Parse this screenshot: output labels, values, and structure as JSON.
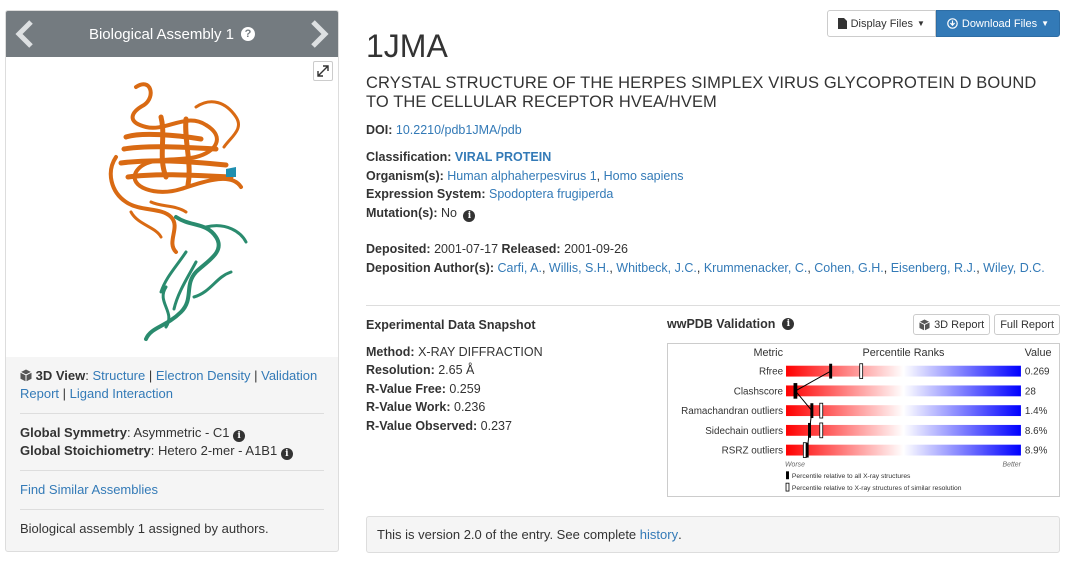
{
  "assembly": {
    "header": "Biological Assembly 1",
    "view_label": "3D View",
    "view_links": [
      "Structure",
      "Electron Density",
      "Validation Report",
      "Ligand Interaction"
    ],
    "symmetry_label": "Global Symmetry",
    "symmetry_value": "Asymmetric - C1",
    "stoich_label": "Global Stoichiometry",
    "stoich_value": "Hetero 2-mer - A1B1",
    "find_similar": "Find Similar Assemblies",
    "assigned_note": "Biological assembly 1 assigned by authors."
  },
  "toolbar": {
    "display_files": "Display Files",
    "download_files": "Download Files"
  },
  "entry": {
    "id": "1JMA",
    "title": "CRYSTAL STRUCTURE OF THE HERPES SIMPLEX VIRUS GLYCOPROTEIN D BOUND TO THE CELLULAR RECEPTOR HVEA/HVEM",
    "doi_label": "DOI:",
    "doi": "10.2210/pdb1JMA/pdb",
    "classification_label": "Classification:",
    "classification": "VIRAL PROTEIN",
    "organisms_label": "Organism(s):",
    "organisms": [
      "Human alphaherpesvirus 1",
      "Homo sapiens"
    ],
    "expression_label": "Expression System:",
    "expression": "Spodoptera frugiperda",
    "mutation_label": "Mutation(s):",
    "mutation": "No",
    "deposited_label": "Deposited:",
    "deposited": "2001-07-17",
    "released_label": "Released:",
    "released": "2001-09-26",
    "authors_label": "Deposition Author(s):",
    "authors": [
      "Carfi, A.",
      "Willis, S.H.",
      "Whitbeck, J.C.",
      "Krummenacker, C.",
      "Cohen, G.H.",
      "Eisenberg, R.J.",
      "Wiley, D.C."
    ]
  },
  "snapshot": {
    "heading": "Experimental Data Snapshot",
    "rows": [
      {
        "label": "Method:",
        "value": "X-RAY DIFFRACTION"
      },
      {
        "label": "Resolution:",
        "value": "2.65 Å"
      },
      {
        "label": "R-Value Free:",
        "value": "0.259"
      },
      {
        "label": "R-Value Work:",
        "value": "0.236"
      },
      {
        "label": "R-Value Observed:",
        "value": "0.237"
      }
    ]
  },
  "validation": {
    "heading": "wwPDB Validation",
    "report_3d": "3D Report",
    "full_report": "Full Report",
    "col_metric": "Metric",
    "col_percentile": "Percentile Ranks",
    "col_value": "Value",
    "worse": "Worse",
    "better": "Better",
    "legend_all": "Percentile relative to all X-ray structures",
    "legend_similar": "Percentile relative to X-ray structures of similar resolution",
    "metrics": [
      {
        "name": "Rfree",
        "value": "0.269",
        "pct_all": 0.19,
        "pct_similar": 0.32
      },
      {
        "name": "Clashscore",
        "value": "28",
        "pct_all": 0.04,
        "pct_similar": 0.04
      },
      {
        "name": "Ramachandran outliers",
        "value": "1.4%",
        "pct_all": 0.11,
        "pct_similar": 0.15
      },
      {
        "name": "Sidechain outliers",
        "value": "8.6%",
        "pct_all": 0.1,
        "pct_similar": 0.15
      },
      {
        "name": "RSRZ outliers",
        "value": "8.9%",
        "pct_all": 0.09,
        "pct_similar": 0.08
      }
    ]
  },
  "history": {
    "text": "This is version 2.0 of the entry. See complete",
    "link": "history",
    "end": "."
  },
  "colors": {
    "protein_chain_a": "#d96a13",
    "protein_chain_b": "#2a8b6e",
    "header_bg": "#747b80",
    "link": "#337ab7"
  }
}
